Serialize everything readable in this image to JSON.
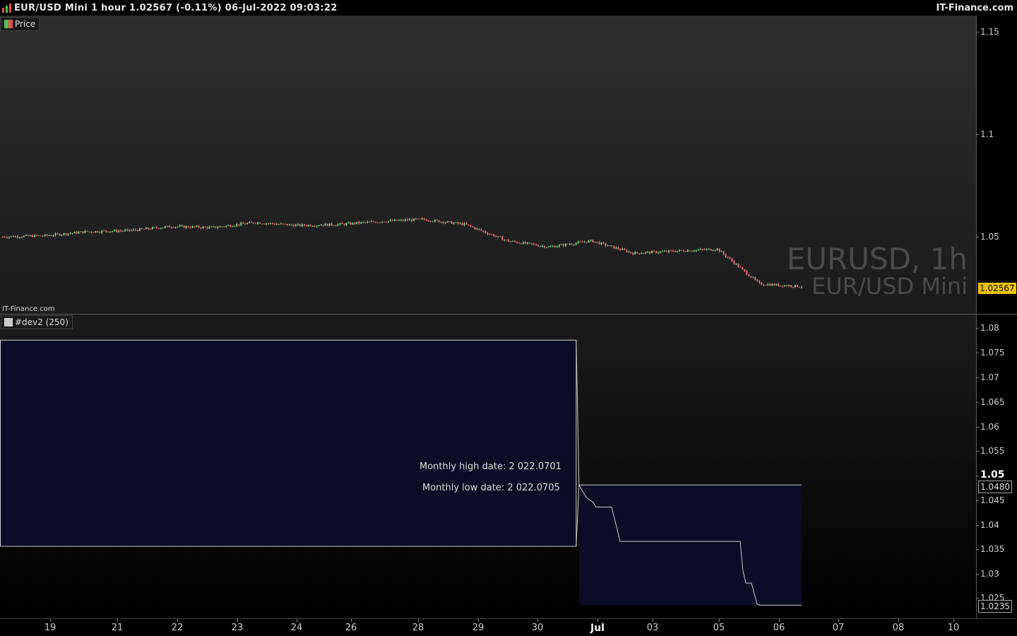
{
  "header": {
    "title": "EUR/USD Mini 1 hour 1.02567 (-0.11%) 06-Jul-2022 09:03:22",
    "brand": "IT-Finance.com"
  },
  "price_pane": {
    "label": "Price",
    "watermark_symbol": "EURUSD, 1h",
    "watermark_name": "EUR/USD Mini",
    "brand_small": "IT-Finance.com",
    "last_price_tag": "1.02567",
    "y_ticks": [
      "1.15",
      "1.1",
      "1.05"
    ]
  },
  "indicator_pane": {
    "label": "#dev2 (250)",
    "y_ticks": [
      "1.08",
      "1.075",
      "1.07",
      "1.065",
      "1.06",
      "1.055",
      "1.05",
      "1.045",
      "1.04",
      "1.035",
      "1.03",
      "1.025"
    ],
    "tag_high": "1.0480",
    "tag_low": "1.0235",
    "note_high": "Monthly high date: 2 022.0701",
    "note_low": "Monthly low date: 2 022.0705"
  },
  "x_axis": {
    "labels": [
      "19",
      "21",
      "22",
      "23",
      "24",
      "26",
      "28",
      "29",
      "30",
      "Jul",
      "03",
      "05",
      "06",
      "07",
      "08",
      "10"
    ]
  },
  "colors": {
    "up_candle": "#7dd87d",
    "down_candle": "#e8707a",
    "price_tag_bg": "#f2c200",
    "box_fill": "#0c0c26",
    "box_stroke": "#cccccc"
  },
  "chart_data": [
    {
      "type": "line",
      "title": "EURUSD, 1h",
      "series": [
        {
          "name": "EUR/USD Mini",
          "x": [
            "2022-06-17",
            "2022-06-18",
            "2022-06-19",
            "2022-06-20",
            "2022-06-21",
            "2022-06-22",
            "2022-06-23",
            "2022-06-24",
            "2022-06-25",
            "2022-06-26",
            "2022-06-27",
            "2022-06-28",
            "2022-06-29",
            "2022-06-30",
            "2022-07-01",
            "2022-07-02",
            "2022-07-03",
            "2022-07-04",
            "2022-07-05",
            "2022-07-06"
          ],
          "values": [
            1.05,
            1.0505,
            1.0525,
            1.053,
            1.055,
            1.0545,
            1.057,
            1.0555,
            1.056,
            1.0575,
            1.0585,
            1.056,
            1.048,
            1.045,
            1.048,
            1.042,
            1.043,
            1.044,
            1.027,
            1.0257
          ]
        }
      ],
      "ylim": [
        1.02,
        1.16
      ]
    },
    {
      "type": "line",
      "title": "#dev2 (250)",
      "series": [
        {
          "x": [
            "2022-06-17",
            "2022-06-30",
            "2022-07-01",
            "2022-07-02",
            "2022-07-03",
            "2022-07-04",
            "2022-07-05",
            "2022-07-06"
          ],
          "values": [
            1.0355,
            1.0355,
            1.048,
            1.044,
            1.0365,
            1.0365,
            1.028,
            1.0235
          ]
        }
      ],
      "ylim": [
        1.0225,
        1.081
      ]
    }
  ]
}
